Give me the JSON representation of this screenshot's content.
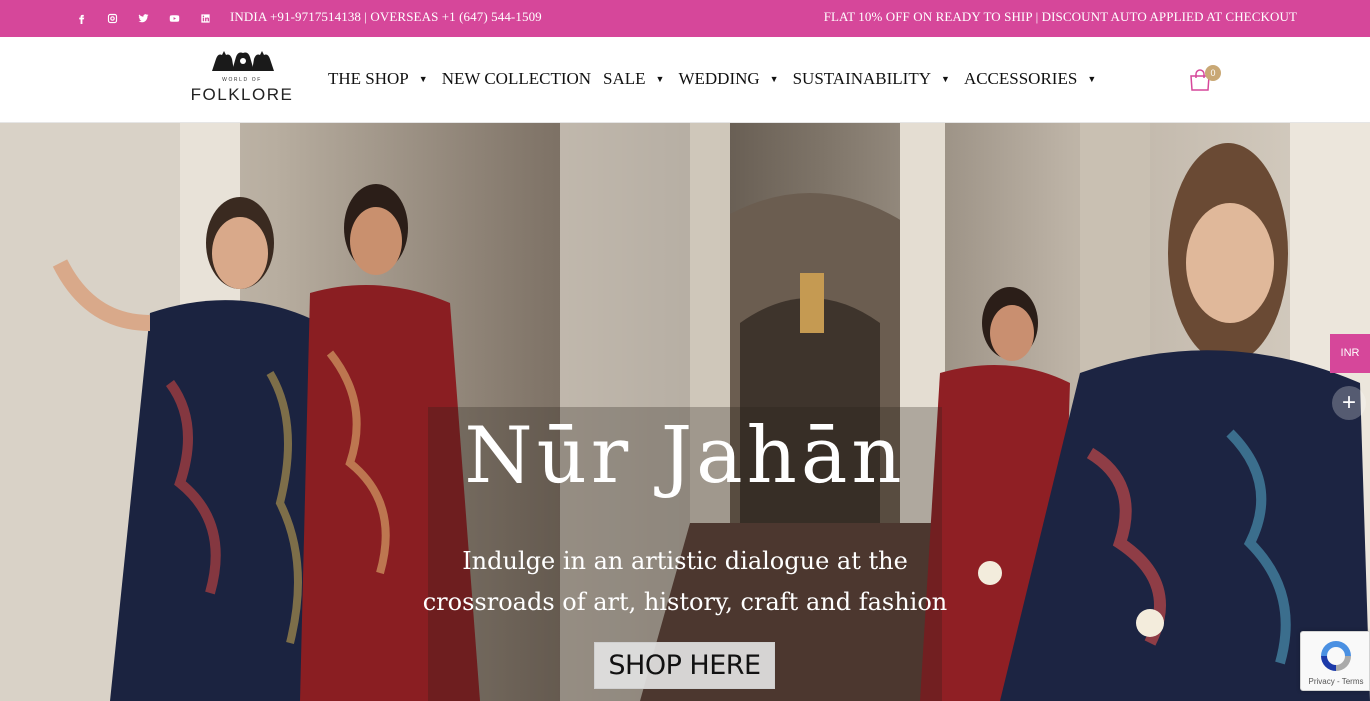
{
  "topbar": {
    "social_icons": [
      "facebook-icon",
      "instagram-icon",
      "twitter-icon",
      "youtube-icon",
      "linkedin-icon"
    ],
    "contact": "INDIA +91-9717514138 | OVERSEAS +1 (647) 544-1509",
    "offer": "FLAT 10% OFF ON READY TO SHIP | DISCOUNT AUTO APPLIED AT CHECKOUT",
    "color": "#d6479a"
  },
  "header": {
    "logo_small": "WORLD OF",
    "logo_big": "FOLKLORE",
    "nav": [
      {
        "label": "THE SHOP",
        "caret": "▼"
      },
      {
        "label": "NEW COLLECTION",
        "caret": ""
      },
      {
        "label": "SALE",
        "caret": "▼"
      },
      {
        "label": "WEDDING",
        "caret": "▼"
      },
      {
        "label": "SUSTAINABILITY",
        "caret": "▼"
      },
      {
        "label": "ACCESSORIES",
        "caret": "▼"
      }
    ],
    "cart_count": "0"
  },
  "hero": {
    "title": "Nūr Jahān",
    "subtitle_line1": "Indulge in an artistic dialogue at the",
    "subtitle_line2": "crossroads of art, history, craft and fashion",
    "button": "SHOP HERE"
  },
  "widgets": {
    "currency": "INR",
    "plus": "+",
    "recaptcha_text": "Privacy - Terms"
  }
}
